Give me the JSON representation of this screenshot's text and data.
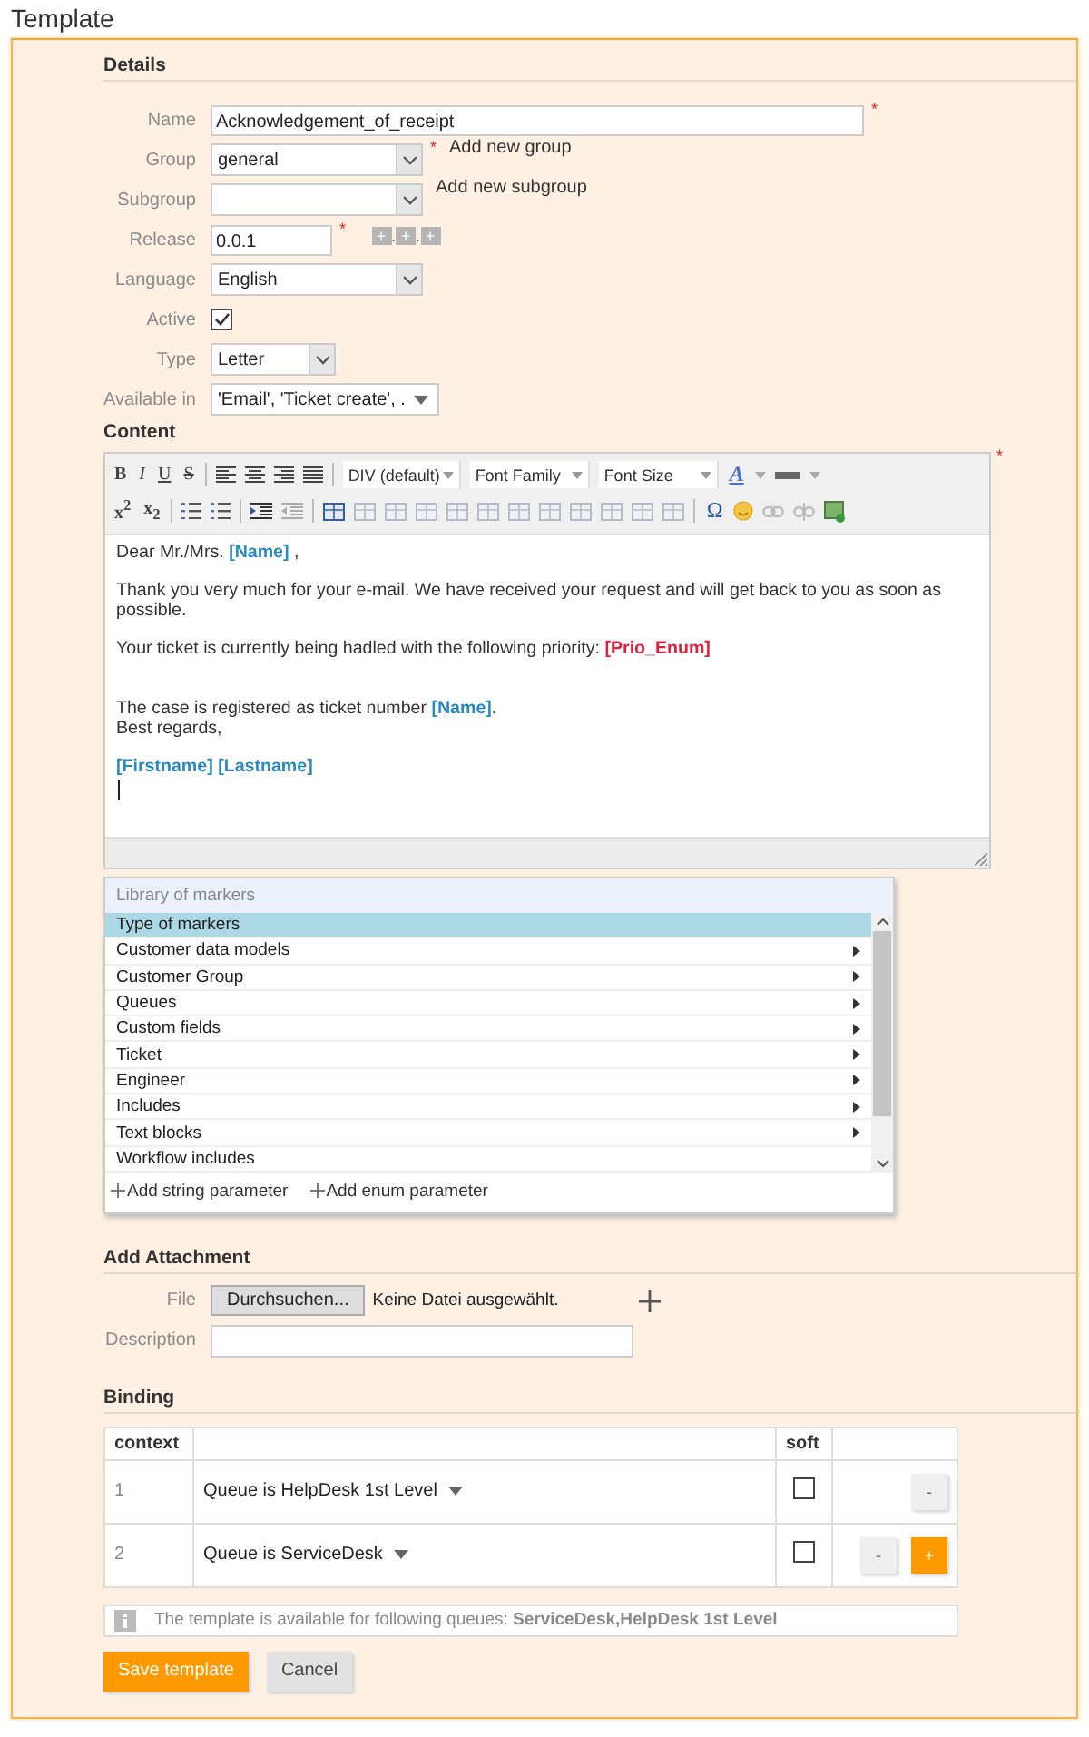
{
  "page_title": "Template",
  "details": {
    "heading": "Details",
    "fields": [
      {
        "kind": "text",
        "label": "Name",
        "value": "Acknowledgement_of_receipt",
        "required_mark": "*"
      },
      {
        "kind": "select",
        "label": "Group",
        "value": "general",
        "required_mark": "*",
        "link": "Add new group"
      },
      {
        "kind": "select",
        "label": "Subgroup",
        "link": "Add new subgroup"
      },
      {
        "kind": "version",
        "label": "Release",
        "value": "0.0.1",
        "required_mark": "*",
        "increment_buttons": [
          "+",
          "+",
          "+"
        ],
        "separator": "."
      },
      {
        "kind": "select",
        "label": "Language",
        "value": "English"
      },
      {
        "kind": "checkbox",
        "label": "Active",
        "checked": true
      },
      {
        "kind": "select",
        "label": "Type",
        "value": "Letter"
      },
      {
        "kind": "multiselect",
        "label": "Available in",
        "value": "'Email', 'Ticket create', ."
      }
    ]
  },
  "content": {
    "heading": "Content",
    "required_mark": "*",
    "toolbar": {
      "format_buttons": [
        "B",
        "I",
        "U",
        "S"
      ],
      "block_format": "DIV (default)",
      "font_family": "Font Family",
      "font_size": "Font Size",
      "font_color_button": "A",
      "script_buttons": [
        "x$^{2}$",
        "x$_{2}$"
      ],
      "special_char_button": "Ω"
    },
    "body": [
      [
        [
          {
            "kind": "plain",
            "text": "Dear Mr./Mrs. "
          },
          {
            "kind": "marker",
            "text": "[Name]"
          },
          {
            "kind": "plain",
            "text": " ,"
          }
        ]
      ],
      [
        [
          {
            "kind": "plain",
            "text": "Thank you very much for your e-mail. We have received your request and will get back to you as soon as possible."
          }
        ]
      ],
      [
        [
          {
            "kind": "plain",
            "text": "Your ticket is currently being hadled with the following priority: "
          },
          {
            "kind": "enum_marker",
            "text": "[Prio_Enum]"
          }
        ]
      ],
      [
        [
          {
            "kind": "plain",
            "text": "The case is registered as ticket number "
          },
          {
            "kind": "marker",
            "text": "[Name]"
          },
          {
            "kind": "plain",
            "text": "."
          }
        ],
        [
          {
            "kind": "plain",
            "text": "Best regards,"
          }
        ]
      ],
      [
        [
          {
            "kind": "marker",
            "text": "[Firstname] [Lastname]"
          }
        ]
      ]
    ]
  },
  "marker_library": {
    "title": "Library of markers",
    "items": [
      {
        "label": "Type of markers",
        "selected": true,
        "has_submenu": false
      },
      {
        "label": "Customer data models",
        "selected": false,
        "has_submenu": true
      },
      {
        "label": "Customer Group",
        "selected": false,
        "has_submenu": true
      },
      {
        "label": "Queues",
        "selected": false,
        "has_submenu": true
      },
      {
        "label": "Custom fields",
        "selected": false,
        "has_submenu": true
      },
      {
        "label": "Ticket",
        "selected": false,
        "has_submenu": true
      },
      {
        "label": "Engineer",
        "selected": false,
        "has_submenu": true
      },
      {
        "label": "Includes",
        "selected": false,
        "has_submenu": true
      },
      {
        "label": "Text blocks",
        "selected": false,
        "has_submenu": true
      },
      {
        "label": "Workflow includes",
        "selected": false,
        "has_submenu": false
      }
    ],
    "actions": [
      "Add string parameter",
      "Add enum parameter"
    ]
  },
  "attachment": {
    "heading": "Add Attachment",
    "file_label": "File",
    "browse_button": "Durchsuchen...",
    "file_status": "Keine Datei ausgewählt.",
    "description_label": "Description"
  },
  "binding": {
    "heading": "Binding",
    "columns": [
      "context",
      "soft"
    ],
    "rows": [
      {
        "number": "1",
        "condition": "Queue is HelpDesk 1st Level",
        "soft": false,
        "buttons": [
          {
            "kind": "remove",
            "label": "-"
          }
        ]
      },
      {
        "number": "2",
        "condition": "Queue is ServiceDesk",
        "soft": false,
        "buttons": [
          {
            "kind": "remove",
            "label": "-"
          },
          {
            "kind": "add",
            "label": "+"
          }
        ]
      }
    ],
    "info": "The template is available for following queues: **ServiceDesk,HelpDesk 1st Level**"
  },
  "buttons": [
    {
      "kind": "primary",
      "label": "Save template"
    },
    {
      "kind": "secondary",
      "label": "Cancel"
    }
  ]
}
